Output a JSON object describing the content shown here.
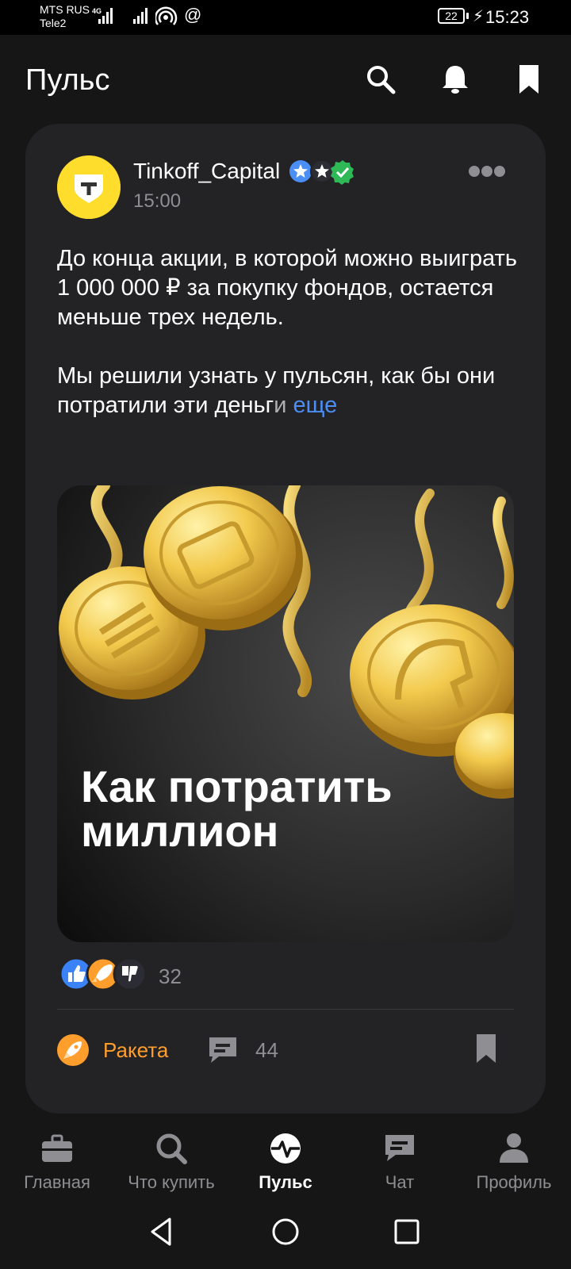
{
  "status_bar": {
    "carrier_1": "MTS RUS",
    "carrier_2": "Tele2",
    "network": "4G",
    "battery": "22",
    "time": "15:23"
  },
  "header": {
    "title": "Пульс",
    "icons": [
      "search-icon",
      "bell-icon",
      "bookmark-icon"
    ]
  },
  "post": {
    "author": "Tinkoff_Capital",
    "time": "15:00",
    "paragraph_1": "До конца акции, в которой можно выиграть 1 000 000 ₽ за покупку фондов, остается меньше трех недель.",
    "paragraph_2_main": "Мы решили узнать у пульсян, как бы они потратили эти деньг",
    "paragraph_2_fade": "и",
    "more_label": "еще",
    "image_caption": "Как потратить миллион",
    "reactions_count": "32",
    "rocket_label": "Ракета",
    "comments_count": "44"
  },
  "bottom_nav": {
    "items": [
      {
        "label": "Главная",
        "icon": "briefcase-icon"
      },
      {
        "label": "Что купить",
        "icon": "search-icon"
      },
      {
        "label": "Пульс",
        "icon": "pulse-icon"
      },
      {
        "label": "Чат",
        "icon": "chat-icon"
      },
      {
        "label": "Профиль",
        "icon": "profile-icon"
      }
    ],
    "active_index": 2
  },
  "colors": {
    "background": "#161616",
    "card": "#232325",
    "accent_link": "#4b8ef5",
    "rocket_orange": "#ff9e2c",
    "tinkoff_yellow": "#ffdd2d"
  }
}
